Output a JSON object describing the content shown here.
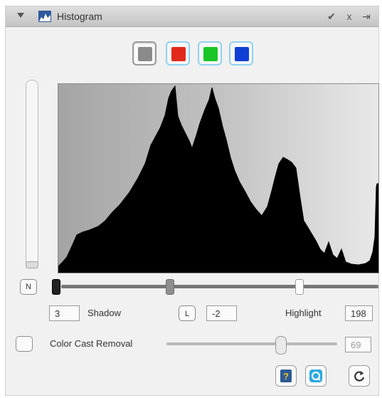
{
  "panel": {
    "title": "Histogram",
    "icons": [
      "disclosure-triangle-icon",
      "histogram-icon",
      "checkmark-icon",
      "close-x-icon",
      "panel-menu-icon"
    ],
    "titlebar_buttons": {
      "check": "✔",
      "close": "x",
      "menu": "⇥"
    }
  },
  "channels": [
    {
      "name": "luminosity",
      "color": "#8a8a8a",
      "selected": true
    },
    {
      "name": "red",
      "color": "#e12a1a",
      "selected": false
    },
    {
      "name": "green",
      "color": "#19c626",
      "selected": false
    },
    {
      "name": "blue",
      "color": "#1040d6",
      "selected": false
    }
  ],
  "levels": {
    "n_button": "N",
    "shadow_value": "3",
    "shadow_label": "Shadow",
    "l_button": "L",
    "midtone_value": "-2",
    "highlight_label": "Highlight",
    "highlight_value": "198"
  },
  "color_cast": {
    "label": "Color Cast Removal",
    "value": "69",
    "checked": false
  },
  "footer_buttons": [
    "help-icon",
    "auto-correct-icon",
    "reset-icon"
  ]
}
